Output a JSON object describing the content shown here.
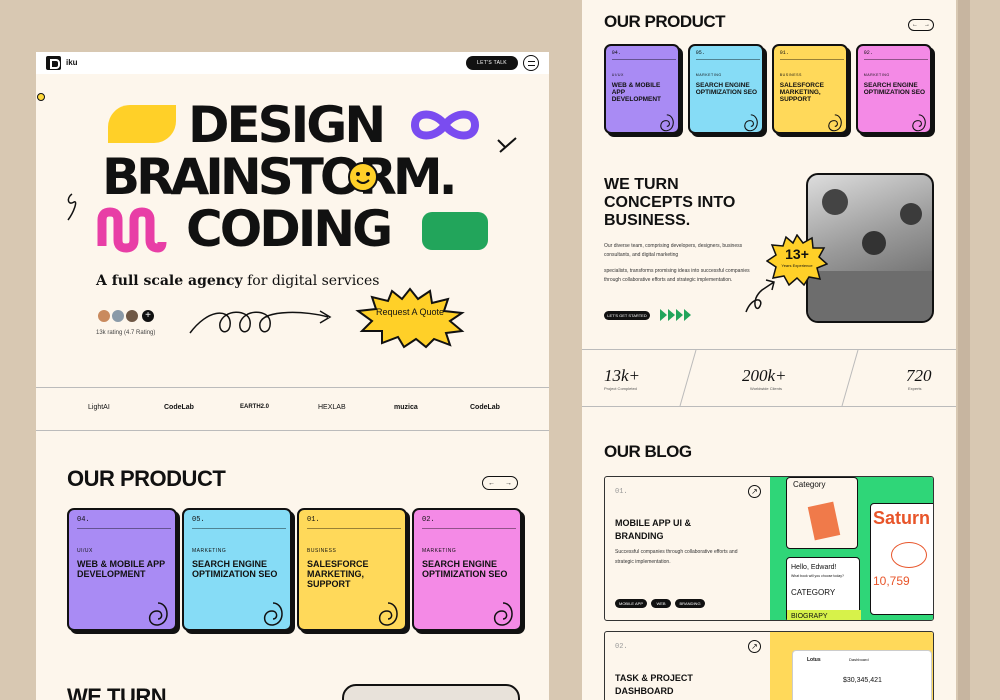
{
  "nav": {
    "brand": "iku",
    "cta": "LET'S TALK"
  },
  "hero": {
    "line1": "DESIGN",
    "line2": "BRAINSTORM.",
    "line3": "CODING",
    "tagline_bold": "A full scale agency",
    "tagline_rest": " for digital services",
    "rating_main": "13k rating",
    "rating_sub": "(4.7 Rating)",
    "request": "Request A Quote"
  },
  "partners": [
    "LightAI",
    "CodeLab",
    "EARTH2.0",
    "HEXLAB",
    "muzica",
    "CodeLab"
  ],
  "product": {
    "title": "OUR PRODUCT",
    "prev": "←",
    "next": "→",
    "cards": [
      {
        "num": "04.",
        "category": "UI/UX",
        "title": "WEB & MOBILE APP DEVELOPMENT",
        "color": "#a98bf4"
      },
      {
        "num": "05.",
        "category": "MARKETING",
        "title": "SEARCH ENGINE OPTIMIZATION SEO",
        "color": "#86dcf6"
      },
      {
        "num": "01.",
        "category": "BUSINESS",
        "title": "SALESFORCE MARKETING, SUPPORT",
        "color": "#ffd95a"
      },
      {
        "num": "02.",
        "category": "MARKETING",
        "title": "SEARCH ENGINE OPTIMIZATION SEO",
        "color": "#f48ae6"
      }
    ]
  },
  "concepts": {
    "title_left": "WE TURN",
    "title": "WE TURN CONCEPTS INTO BUSINESS.",
    "body1": "Our diverse team, comprising developers, designers, business consultants, and digital marketing",
    "body2": "specialists, transforms promising ideas into successful companies through collaborative efforts and strategic implementation.",
    "cta": "LET'S GET STARTED",
    "badge_num": "13+",
    "badge_txt": "Years Experience"
  },
  "stats": [
    {
      "value": "13k+",
      "label": "Project Completed"
    },
    {
      "value": "200k+",
      "label": "Worldwide Clients"
    },
    {
      "value": "720",
      "label": "Experts"
    }
  ],
  "blog": {
    "title": "OUR BLOG",
    "post1": {
      "num": "01.",
      "title": "MOBILE APP UI & BRANDING",
      "body": "Successful companies through collaborative efforts and strategic implementation.",
      "tags": [
        "MOBILE APP",
        "WEB",
        "BRANDING"
      ]
    },
    "post2": {
      "num": "02.",
      "title": "TASK & PROJECT DASHBOARD"
    },
    "mock": {
      "category": "Category",
      "hello": "Hello, Edward!",
      "ask": "What book will you choose today?",
      "category2": "CATEGORY",
      "biography": "BIOGRAPY",
      "saturn": "Saturn",
      "big": "10,759",
      "lotus": "Lotus",
      "balance": "$30,345,421",
      "dashboard": "Dashboard"
    }
  }
}
